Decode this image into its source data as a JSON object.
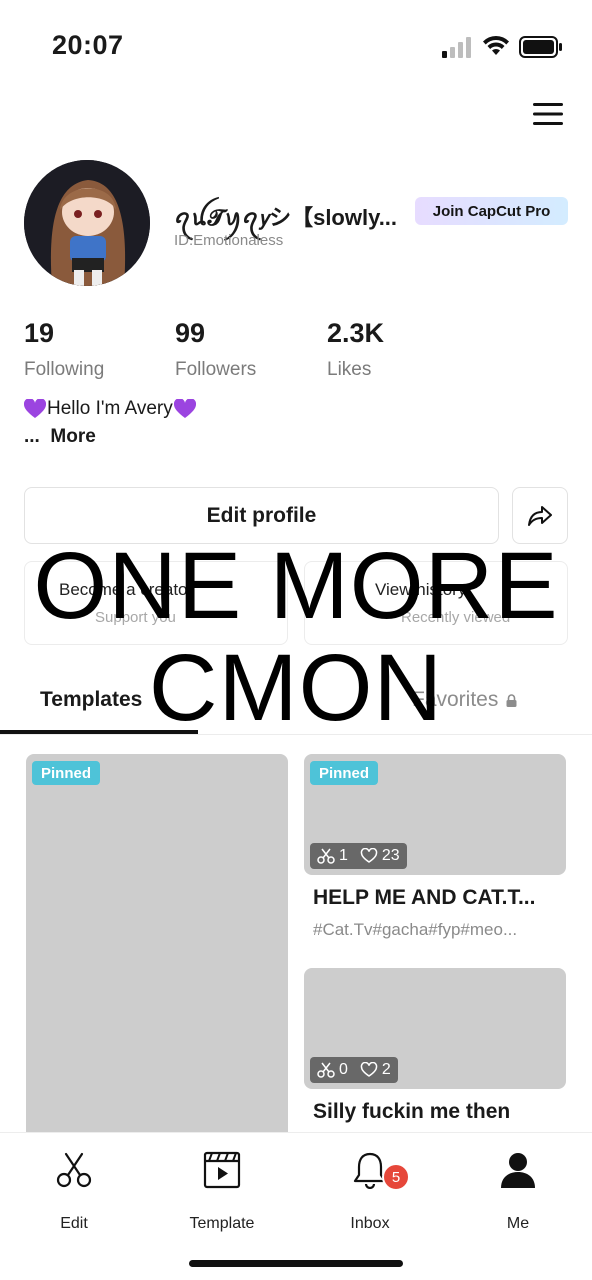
{
  "status_bar": {
    "time": "20:07"
  },
  "profile": {
    "username": "ꪖꪊ𝓣ꪗꪖ𝘺シ【slowly...",
    "id": "ID:Emotionaless",
    "pro_badge": "Join CapCut Pro",
    "stats": [
      {
        "value": "19",
        "label": "Following"
      },
      {
        "value": "99",
        "label": "Followers"
      },
      {
        "value": "2.3K",
        "label": "Likes"
      }
    ],
    "bio": "Hello I'm Avery",
    "bio_more_prefix": "...",
    "bio_more": "More"
  },
  "actions": {
    "edit_profile": "Edit profile",
    "card_left": {
      "title": "Become a creator",
      "sub": "Support you"
    },
    "card_right": {
      "title": "View history",
      "sub": "Recently viewed"
    }
  },
  "tabs": [
    {
      "label": "Templates"
    },
    {
      "label": "Favorites"
    }
  ],
  "overlay": {
    "line1": "ONE MORE",
    "line2": "CMON"
  },
  "grid": {
    "pinned_label": "Pinned",
    "items": [
      {
        "pinned": true
      },
      {
        "pinned": true,
        "uses": "1",
        "likes": "23",
        "title": "HELP ME AND CAT.T...",
        "tags": "#Cat.Tv#gacha#fyp#meo..."
      },
      {
        "pinned": false,
        "uses": "0",
        "likes": "2",
        "title": "Silly fuckin me then"
      }
    ]
  },
  "nav": {
    "items": [
      {
        "label": "Edit",
        "icon": "scissors-icon"
      },
      {
        "label": "Template",
        "icon": "template-icon"
      },
      {
        "label": "Inbox",
        "icon": "bell-icon",
        "badge": "5"
      },
      {
        "label": "Me",
        "icon": "person-icon"
      }
    ]
  },
  "colors": {
    "pinned": "#4ec3d8",
    "badge": "#e6473a",
    "thumb": "#cdcdcd"
  }
}
